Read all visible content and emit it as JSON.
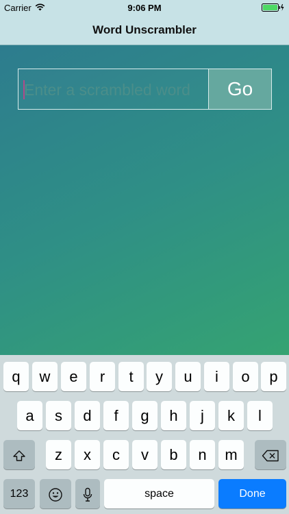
{
  "status_bar": {
    "carrier": "Carrier",
    "time": "9:06 PM"
  },
  "nav": {
    "title": "Word Unscrambler"
  },
  "search": {
    "placeholder": "Enter a scrambled word",
    "value": "",
    "go_label": "Go"
  },
  "keyboard": {
    "row1": [
      "q",
      "w",
      "e",
      "r",
      "t",
      "y",
      "u",
      "i",
      "o",
      "p"
    ],
    "row2": [
      "a",
      "s",
      "d",
      "f",
      "g",
      "h",
      "j",
      "k",
      "l"
    ],
    "row3": [
      "z",
      "x",
      "c",
      "v",
      "b",
      "n",
      "m"
    ],
    "numbers_label": "123",
    "space_label": "space",
    "done_label": "Done"
  },
  "colors": {
    "accent": "#0a7cff",
    "go_button": "#65a89f",
    "cursor": "#b24a8a"
  },
  "icons": [
    "wifi-icon",
    "battery-icon",
    "shift-icon",
    "delete-icon",
    "emoji-icon",
    "microphone-icon"
  ]
}
